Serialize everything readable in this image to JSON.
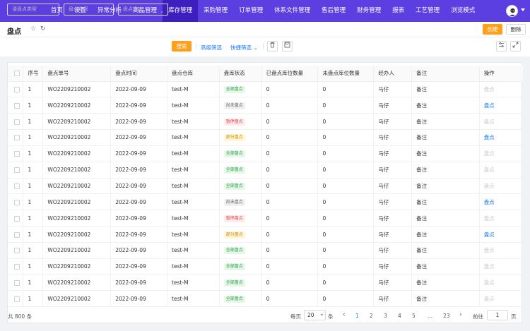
{
  "nav": {
    "items": [
      "首页",
      "设置",
      "异常分析",
      "商品管理",
      "库存管理",
      "采购管理",
      "订单管理",
      "体系文件管理",
      "售后管理",
      "财务管理",
      "报表",
      "工艺管理",
      "浏览模式"
    ],
    "active_index": 4
  },
  "page": {
    "title": "盘点",
    "create_label": "创建",
    "delete_label": "删除"
  },
  "filters": {
    "type_placeholder": "请盘点类型",
    "code_placeholder": "盘点单号",
    "warehouse_placeholder": "盘点仓库",
    "search_label": "搜索",
    "advanced_label": "高级筛选",
    "quick_label": "快捷筛选"
  },
  "table": {
    "columns": [
      "序号",
      "盘点单号",
      "盘点时间",
      "盘点仓库",
      "盘库状态",
      "已盘点库位数量",
      "未盘点库位数量",
      "经办人",
      "备注",
      "操作"
    ],
    "rows": [
      {
        "seq": "1",
        "code": "WO2209210002",
        "date": "2022-09-09",
        "warehouse": "test-M",
        "status": "全部盘点",
        "done": "0",
        "todo": "0",
        "handler": "马仔",
        "note": "备注",
        "op": "盘点",
        "op_enabled": false
      },
      {
        "seq": "1",
        "code": "WO2209210002",
        "date": "2022-09-09",
        "warehouse": "test-M",
        "status": "尚未盘点",
        "done": "0",
        "todo": "0",
        "handler": "马仔",
        "note": "备注",
        "op": "盘点",
        "op_enabled": true
      },
      {
        "seq": "1",
        "code": "WO2209210002",
        "date": "2022-09-09",
        "warehouse": "test-M",
        "status": "暂停盘点",
        "done": "0",
        "todo": "0",
        "handler": "马仔",
        "note": "备注",
        "op": "盘点",
        "op_enabled": false
      },
      {
        "seq": "1",
        "code": "WO2209210002",
        "date": "2022-09-09",
        "warehouse": "test-M",
        "status": "部分盘点",
        "done": "0",
        "todo": "0",
        "handler": "马仔",
        "note": "备注",
        "op": "盘点",
        "op_enabled": true
      },
      {
        "seq": "1",
        "code": "WO2209210002",
        "date": "2022-09-09",
        "warehouse": "test-M",
        "status": "全部盘点",
        "done": "0",
        "todo": "0",
        "handler": "马仔",
        "note": "备注",
        "op": "盘点",
        "op_enabled": false
      },
      {
        "seq": "1",
        "code": "WO2209210002",
        "date": "2022-09-09",
        "warehouse": "test-M",
        "status": "全部盘点",
        "done": "0",
        "todo": "0",
        "handler": "马仔",
        "note": "备注",
        "op": "盘点",
        "op_enabled": false
      },
      {
        "seq": "1",
        "code": "WO2209210002",
        "date": "2022-09-09",
        "warehouse": "test-M",
        "status": "全部盘点",
        "done": "0",
        "todo": "0",
        "handler": "马仔",
        "note": "备注",
        "op": "盘点",
        "op_enabled": false
      },
      {
        "seq": "1",
        "code": "WO2209210002",
        "date": "2022-09-09",
        "warehouse": "test-M",
        "status": "尚未盘点",
        "done": "0",
        "todo": "0",
        "handler": "马仔",
        "note": "备注",
        "op": "盘点",
        "op_enabled": true
      },
      {
        "seq": "1",
        "code": "WO2209210002",
        "date": "2022-09-09",
        "warehouse": "test-M",
        "status": "暂停盘点",
        "done": "0",
        "todo": "0",
        "handler": "马仔",
        "note": "备注",
        "op": "盘点",
        "op_enabled": false
      },
      {
        "seq": "1",
        "code": "WO2209210002",
        "date": "2022-09-09",
        "warehouse": "test-M",
        "status": "部分盘点",
        "done": "0",
        "todo": "0",
        "handler": "马仔",
        "note": "备注",
        "op": "盘点",
        "op_enabled": true
      },
      {
        "seq": "1",
        "code": "WO2209210002",
        "date": "2022-09-09",
        "warehouse": "test-M",
        "status": "全部盘点",
        "done": "0",
        "todo": "0",
        "handler": "马仔",
        "note": "备注",
        "op": "盘点",
        "op_enabled": false
      },
      {
        "seq": "1",
        "code": "WO2209210002",
        "date": "2022-09-09",
        "warehouse": "test-M",
        "status": "全部盘点",
        "done": "0",
        "todo": "0",
        "handler": "马仔",
        "note": "备注",
        "op": "盘点",
        "op_enabled": false
      },
      {
        "seq": "1",
        "code": "WO2209210002",
        "date": "2022-09-09",
        "warehouse": "test-M",
        "status": "全部盘点",
        "done": "0",
        "todo": "0",
        "handler": "马仔",
        "note": "备注",
        "op": "盘点",
        "op_enabled": false
      },
      {
        "seq": "1",
        "code": "WO2209210002",
        "date": "2022-09-09",
        "warehouse": "test-M",
        "status": "全部盘点",
        "done": "0",
        "todo": "0",
        "handler": "马仔",
        "note": "备注",
        "op": "盘点",
        "op_enabled": false
      }
    ]
  },
  "status_colors": {
    "全部盘点": {
      "fg": "#2ea043",
      "bg": "#e6f7ea"
    },
    "尚未盘点": {
      "fg": "#666666",
      "bg": "#f0f0f2"
    },
    "暂停盘点": {
      "fg": "#e5484d",
      "bg": "#fdecec"
    },
    "部分盘点": {
      "fg": "#d48806",
      "bg": "#fff6d6"
    }
  },
  "pagination": {
    "total": "共 800 条",
    "per_page_label": "每页",
    "per_page": "20",
    "unit": "条",
    "prev": "‹",
    "pages": [
      "1",
      "2",
      "3",
      "4",
      "5",
      "...",
      "23"
    ],
    "current": "1",
    "next": "›",
    "goto_label": "前往",
    "goto_value": "1",
    "page_suffix": "页"
  },
  "colors": {
    "brand": "#5b3fe0",
    "accent": "#ff9f1c",
    "link": "#1677ff"
  }
}
